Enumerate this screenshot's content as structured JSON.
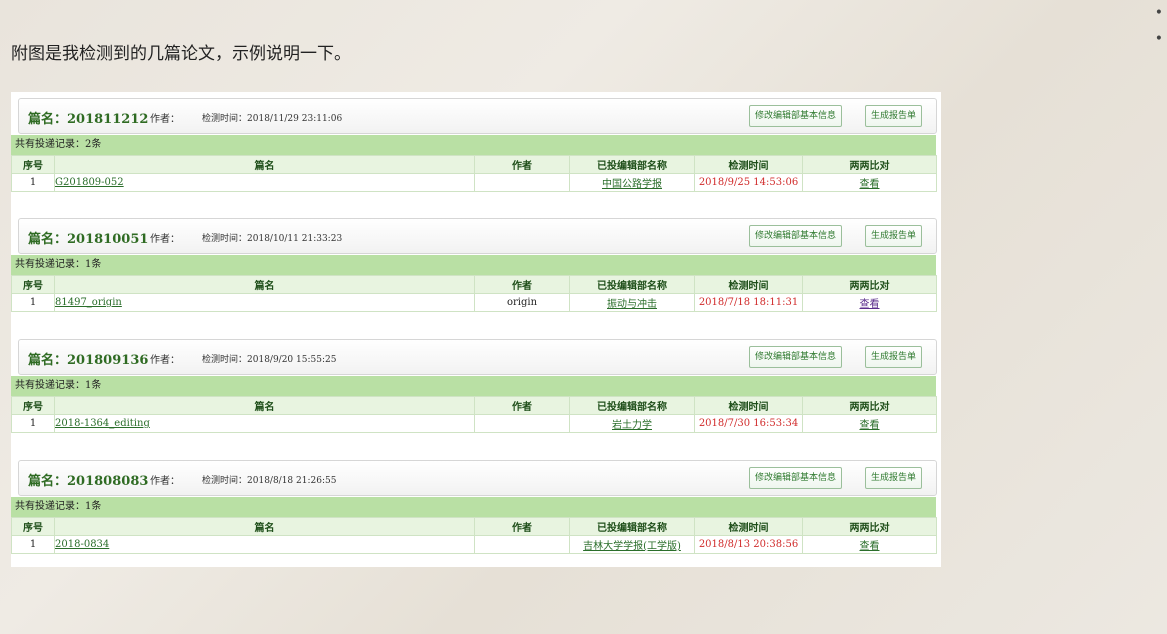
{
  "intro_text": "附图是我检测到的几篇论文，示例说明一下。",
  "bullets": [
    "•",
    "•"
  ],
  "labels": {
    "author": "作者：",
    "time": "检测时间：",
    "edit_button": "修改编辑部基本信息",
    "report_button": "生成报告单"
  },
  "columns": [
    "序号",
    "篇名",
    "作者",
    "已投编辑部名称",
    "检测时间",
    "两两比对"
  ],
  "blocks": [
    {
      "title": "篇名：201811212",
      "detect_time": "2018/11/29 23:11:06",
      "count": "共有投递记录：2条",
      "row": {
        "index": "1",
        "name": "G201809-052",
        "author": "",
        "journal": "中国公路学报",
        "time": "2018/9/25 14:53:06",
        "compare": "查看"
      }
    },
    {
      "title": "篇名：201810051",
      "detect_time": "2018/10/11 21:33:23",
      "count": "共有投递记录：1条",
      "row": {
        "index": "1",
        "name": "81497_origin",
        "author": "origin",
        "journal": "振动与冲击",
        "time": "2018/7/18 18:11:31",
        "compare": "查看"
      }
    },
    {
      "title": "篇名：201809136",
      "detect_time": "2018/9/20 15:55:25",
      "count": "共有投递记录：1条",
      "row": {
        "index": "1",
        "name": "2018-1364_editing",
        "author": "",
        "journal": "岩土力学",
        "time": "2018/7/30 16:53:34",
        "compare": "查看"
      }
    },
    {
      "title": "篇名：201808083",
      "detect_time": "2018/8/18 21:26:55",
      "count": "共有投递记录：1条",
      "row": {
        "index": "1",
        "name": "2018-0834",
        "author": "",
        "journal": "吉林大学学报(工学版)",
        "time": "2018/8/13 20:38:56",
        "compare": "查看"
      }
    }
  ]
}
